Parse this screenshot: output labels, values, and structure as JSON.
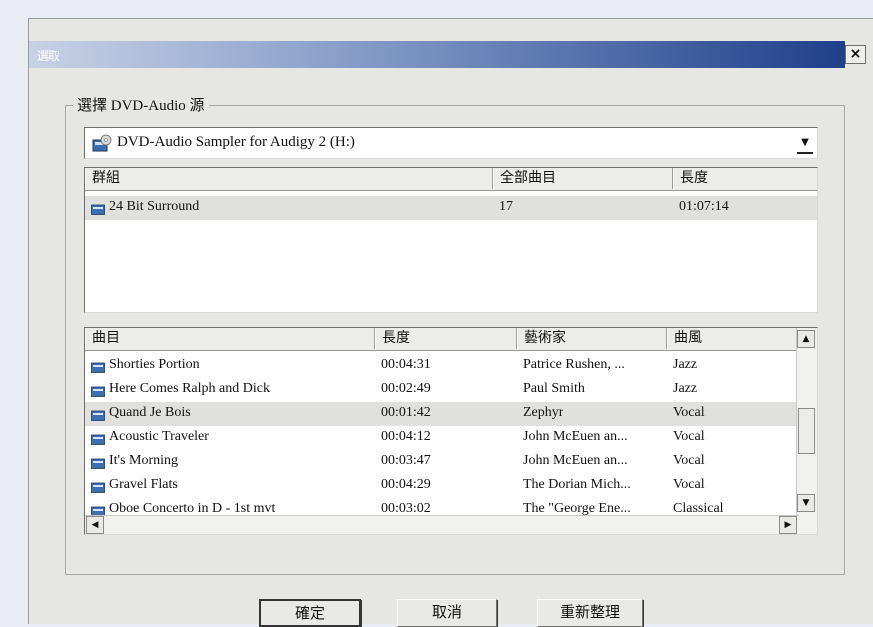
{
  "window": {
    "title": "選取"
  },
  "source_group": {
    "label": "選擇 DVD-Audio 源",
    "selected_source": "DVD-Audio Sampler for Audigy 2 (H:)"
  },
  "groups_table": {
    "columns": [
      "群組",
      "全部曲目",
      "長度"
    ],
    "rows": [
      {
        "name": "24 Bit Surround",
        "tracks": "17",
        "length": "01:07:14",
        "selected": true
      }
    ]
  },
  "tracks_table": {
    "columns": [
      "曲目",
      "長度",
      "藝術家",
      "曲風"
    ],
    "rows": [
      {
        "title": "Shorties Portion",
        "length": "00:04:31",
        "artist": "Patrice Rushen, ...",
        "genre": "Jazz"
      },
      {
        "title": "Here Comes Ralph and Dick",
        "length": "00:02:49",
        "artist": "Paul Smith",
        "genre": "Jazz"
      },
      {
        "title": "Quand Je Bois",
        "length": "00:01:42",
        "artist": "Zephyr",
        "genre": "Vocal",
        "selected": true
      },
      {
        "title": "Acoustic Traveler",
        "length": "00:04:12",
        "artist": "John McEuen an...",
        "genre": "Vocal"
      },
      {
        "title": "It's Morning",
        "length": "00:03:47",
        "artist": "John McEuen an...",
        "genre": "Vocal"
      },
      {
        "title": "Gravel Flats",
        "length": "00:04:29",
        "artist": "The Dorian Mich...",
        "genre": "Vocal"
      },
      {
        "title": "Oboe Concerto in D - 1st mvt",
        "length": "00:03:02",
        "artist": "The \"George Ene...",
        "genre": "Classical"
      }
    ]
  },
  "buttons": {
    "ok": "確定",
    "cancel": "取消",
    "refresh": "重新整理"
  },
  "icons": {
    "disc": "dvd-audio-disc-icon",
    "track": "audio-track-icon",
    "close": "close-icon"
  }
}
